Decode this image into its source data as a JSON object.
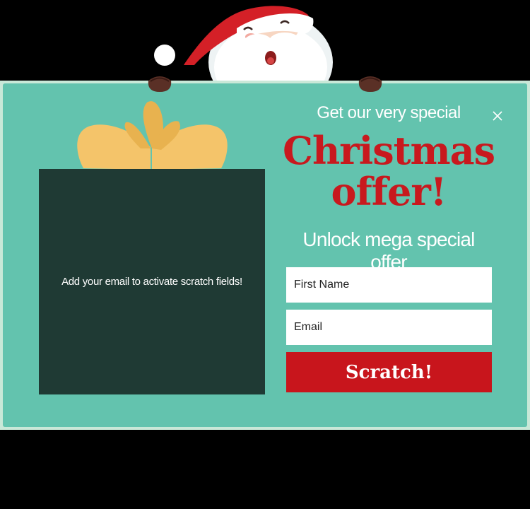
{
  "popup": {
    "subtitle": "Get our very special",
    "headline_line1": "Christmas",
    "headline_line2": "offer!",
    "offer_text": "Unlock mega special offer",
    "scratch_hint": "Add your email to activate scratch fields!",
    "close_icon": "close-icon"
  },
  "form": {
    "first_name_placeholder": "First Name",
    "email_placeholder": "Email",
    "submit_label": "Scratch!"
  },
  "colors": {
    "popup_border": "#c9e8d8",
    "popup_background": "#63c3ae",
    "scratch_panel": "#1f3a34",
    "headline_red": "#c8191e",
    "button_red": "#c8151c",
    "bow_gold": "#f4c46a"
  },
  "icons": {
    "santa": "santa-illustration",
    "gift_bow": "gift-bow-icon",
    "close": "close-icon"
  }
}
